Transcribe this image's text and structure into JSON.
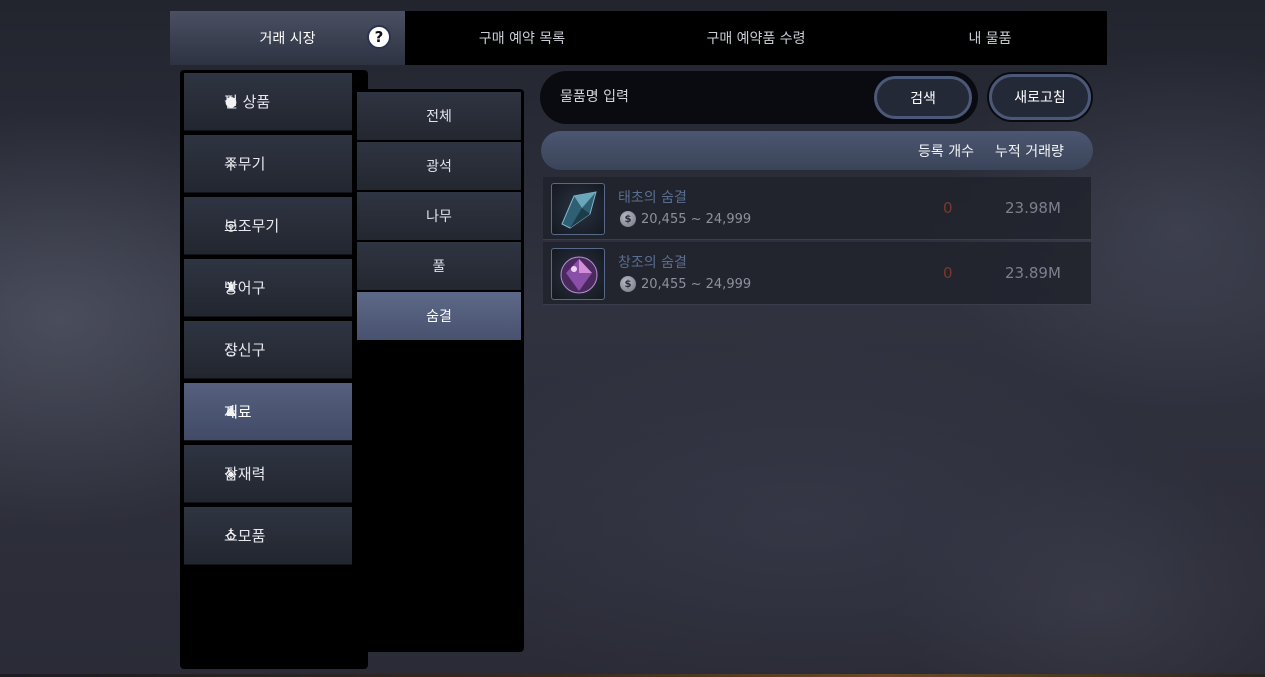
{
  "tabs": [
    {
      "label": "거래 시장",
      "active": true
    },
    {
      "label": "구매 예약 목록",
      "active": false
    },
    {
      "label": "구매 예약품 수령",
      "active": false
    },
    {
      "label": "내 물품",
      "active": false
    }
  ],
  "help_glyph": "?",
  "categories": [
    {
      "label": "펄 상품",
      "icon": "pearl-icon"
    },
    {
      "label": "주무기",
      "icon": "crossed-swords-icon"
    },
    {
      "label": "보조무기",
      "icon": "target-icon"
    },
    {
      "label": "방어구",
      "icon": "armor-icon"
    },
    {
      "label": "장신구",
      "icon": "ring-icon"
    },
    {
      "label": "재료",
      "icon": "pouch-icon",
      "active": true
    },
    {
      "label": "잠재력",
      "icon": "diamond-icon"
    },
    {
      "label": "소모품",
      "icon": "potion-icon"
    }
  ],
  "subcategories": [
    {
      "label": "전체"
    },
    {
      "label": "광석"
    },
    {
      "label": "나무"
    },
    {
      "label": "풀"
    },
    {
      "label": "숨결",
      "active": true
    }
  ],
  "search": {
    "placeholder": "물품명 입력",
    "button_label": "검색"
  },
  "refresh_label": "새로고침",
  "table": {
    "headers": {
      "count": "등록 개수",
      "volume": "누적 거래량"
    },
    "rows": [
      {
        "name": "태초의 숨결",
        "price_range": "20,455 ~ 24,999",
        "count": "0",
        "volume": "23.98M",
        "icon": "blue-crystal-icon"
      },
      {
        "name": "창조의 숨결",
        "price_range": "20,455 ~ 24,999",
        "count": "0",
        "volume": "23.89M",
        "icon": "purple-crystal-icon"
      }
    ]
  },
  "colors": {
    "accent": "#4c5877",
    "active_tab": "#414b68",
    "item_name": "#5a6e90",
    "count_zero": "#7a3a2a"
  }
}
